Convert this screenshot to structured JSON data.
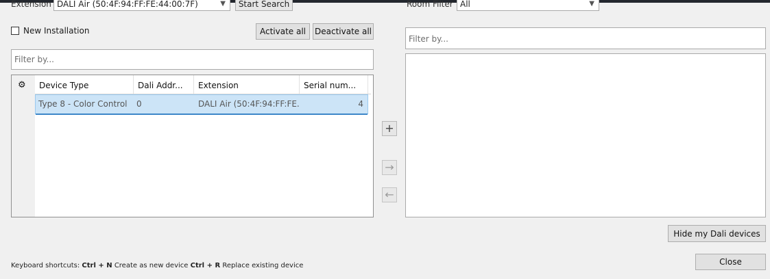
{
  "top_row": {
    "extension_label": "Extension:",
    "extension_value": "DALI Air (50:4F:94:FF:FE:44:00:7F)",
    "start_search_label": "Start Search",
    "room_filter_label": "Room Filter",
    "room_filter_value": "All"
  },
  "left_panel": {
    "new_installation_label": "New Installation",
    "new_installation_checked": false,
    "activate_all_label": "Activate all",
    "deactivate_all_label": "Deactivate all",
    "filter_placeholder": "Filter by...",
    "table": {
      "settings_icon": "gear-icon",
      "columns": [
        "Device Type",
        "Dali Addr...",
        "Extension",
        "Serial num..."
      ],
      "rows": [
        {
          "device_type": "Type 8 - Color Control",
          "dali_addr": "0",
          "extension": "DALI Air (50:4F:94:FF:FE...",
          "serial": "4"
        }
      ]
    }
  },
  "middle": {
    "add_icon": "plus-icon",
    "move_right_icon": "arrow-right-icon",
    "move_left_icon": "arrow-left-icon"
  },
  "right_panel": {
    "filter_placeholder": "Filter by...",
    "hide_button_label": "Hide my Dali devices"
  },
  "footer": {
    "shortcuts_label": "Keyboard shortcuts:",
    "shortcut_1_key": "Ctrl + N",
    "shortcut_1_text": "Create as new device",
    "shortcut_2_key": "Ctrl + R",
    "shortcut_2_text": "Replace existing device",
    "close_label": "Close"
  },
  "colors": {
    "window_bg": "#f0f0f0",
    "selection_bg": "#cce4f7",
    "selection_border": "#3c86c8"
  }
}
